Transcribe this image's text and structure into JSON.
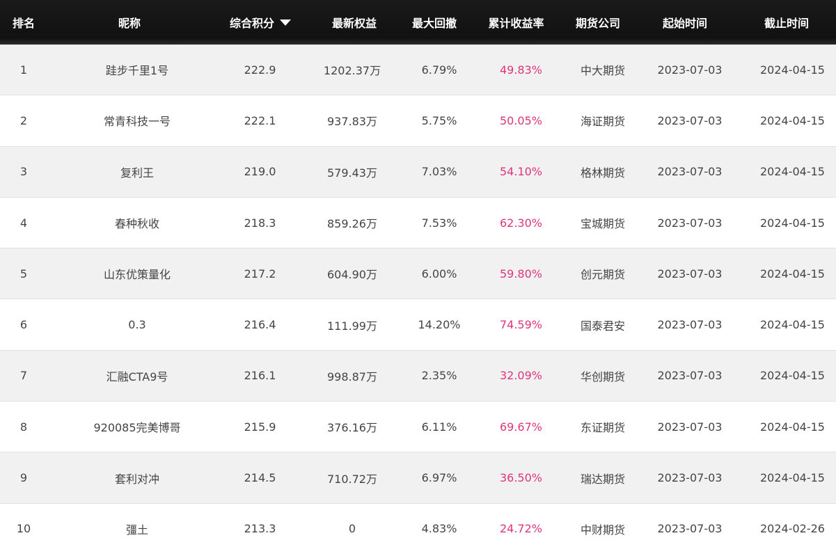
{
  "columns": {
    "rank": "排名",
    "nickname": "昵称",
    "score": "综合积分",
    "equity": "最新权益",
    "max_drawdown": "最大回撤",
    "cum_return": "累计收益率",
    "company": "期货公司",
    "start": "起始时间",
    "end": "截止时间"
  },
  "sort_icon": "caret-down-icon",
  "colors": {
    "header_bg": "#111111",
    "header_text": "#ffffff",
    "row_alt_bg": "#f1f1f1",
    "return_text": "#e0357a",
    "body_text": "#444444"
  },
  "rows": [
    {
      "rank": "1",
      "nickname": "跬步千里1号",
      "score": "222.9",
      "equity": "1202.37万",
      "max_drawdown": "6.79%",
      "cum_return": "49.83%",
      "company": "中大期货",
      "start": "2023-07-03",
      "end": "2024-04-15"
    },
    {
      "rank": "2",
      "nickname": "常青科技一号",
      "score": "222.1",
      "equity": "937.83万",
      "max_drawdown": "5.75%",
      "cum_return": "50.05%",
      "company": "海证期货",
      "start": "2023-07-03",
      "end": "2024-04-15"
    },
    {
      "rank": "3",
      "nickname": "复利王",
      "score": "219.0",
      "equity": "579.43万",
      "max_drawdown": "7.03%",
      "cum_return": "54.10%",
      "company": "格林期货",
      "start": "2023-07-03",
      "end": "2024-04-15"
    },
    {
      "rank": "4",
      "nickname": "春种秋收",
      "score": "218.3",
      "equity": "859.26万",
      "max_drawdown": "7.53%",
      "cum_return": "62.30%",
      "company": "宝城期货",
      "start": "2023-07-03",
      "end": "2024-04-15"
    },
    {
      "rank": "5",
      "nickname": "山东优策量化",
      "score": "217.2",
      "equity": "604.90万",
      "max_drawdown": "6.00%",
      "cum_return": "59.80%",
      "company": "创元期货",
      "start": "2023-07-03",
      "end": "2024-04-15"
    },
    {
      "rank": "6",
      "nickname": "0.3",
      "score": "216.4",
      "equity": "111.99万",
      "max_drawdown": "14.20%",
      "cum_return": "74.59%",
      "company": "国泰君安",
      "start": "2023-07-03",
      "end": "2024-04-15"
    },
    {
      "rank": "7",
      "nickname": "汇融CTA9号",
      "score": "216.1",
      "equity": "998.87万",
      "max_drawdown": "2.35%",
      "cum_return": "32.09%",
      "company": "华创期货",
      "start": "2023-07-03",
      "end": "2024-04-15"
    },
    {
      "rank": "8",
      "nickname": "920085完美博哥",
      "score": "215.9",
      "equity": "376.16万",
      "max_drawdown": "6.11%",
      "cum_return": "69.67%",
      "company": "东证期货",
      "start": "2023-07-03",
      "end": "2024-04-15"
    },
    {
      "rank": "9",
      "nickname": "套利对冲",
      "score": "214.5",
      "equity": "710.72万",
      "max_drawdown": "6.97%",
      "cum_return": "36.50%",
      "company": "瑞达期货",
      "start": "2023-07-03",
      "end": "2024-04-15"
    },
    {
      "rank": "10",
      "nickname": "彊土",
      "score": "213.3",
      "equity": "0",
      "max_drawdown": "4.83%",
      "cum_return": "24.72%",
      "company": "中财期货",
      "start": "2023-07-03",
      "end": "2024-02-26"
    }
  ]
}
